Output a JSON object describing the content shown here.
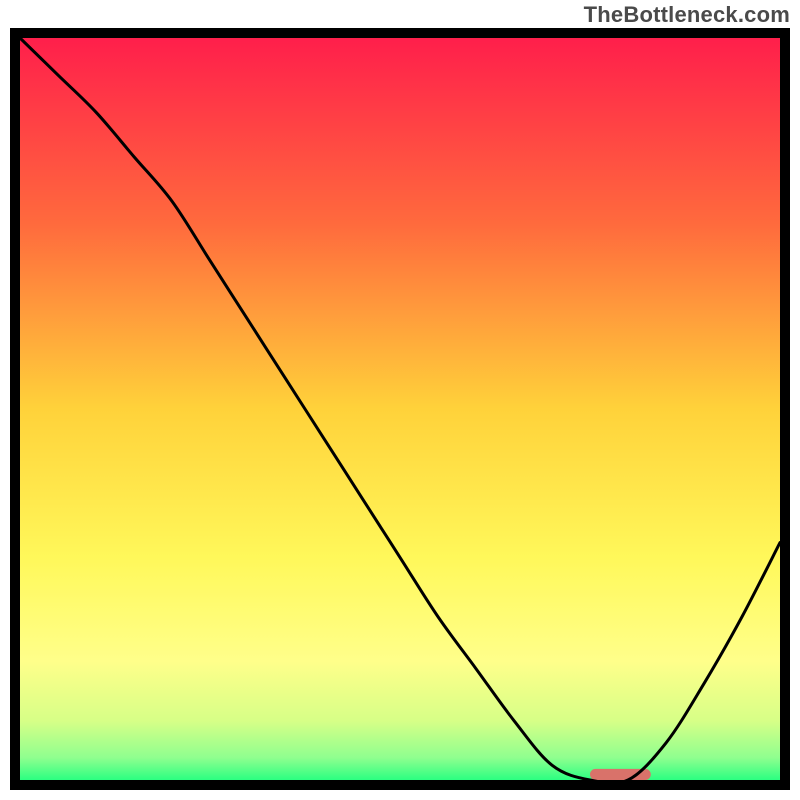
{
  "watermark": "TheBottleneck.com",
  "chart_data": {
    "type": "line",
    "title": "",
    "xlabel": "",
    "ylabel": "",
    "xlim": [
      0,
      100
    ],
    "ylim": [
      0,
      100
    ],
    "grid": false,
    "legend": false,
    "x": [
      0,
      5,
      10,
      15,
      20,
      25,
      30,
      35,
      40,
      45,
      50,
      55,
      60,
      65,
      70,
      75,
      80,
      85,
      90,
      95,
      100
    ],
    "series": [
      {
        "name": "curve",
        "color": "#000000",
        "values": [
          100,
          95,
          90,
          84,
          78,
          70,
          62,
          54,
          46,
          38,
          30,
          22,
          15,
          8,
          2,
          0,
          0,
          5,
          13,
          22,
          32
        ]
      }
    ],
    "highlight_bar": {
      "x_start": 75,
      "x_end": 83,
      "y": 0,
      "height": 1.5,
      "color": "#d9726a"
    },
    "gradient_background": {
      "stops": [
        {
          "offset": 0.0,
          "color": "#ff1f4b"
        },
        {
          "offset": 0.25,
          "color": "#ff6a3d"
        },
        {
          "offset": 0.5,
          "color": "#ffd23a"
        },
        {
          "offset": 0.7,
          "color": "#fff85a"
        },
        {
          "offset": 0.84,
          "color": "#ffff8a"
        },
        {
          "offset": 0.92,
          "color": "#d7ff87"
        },
        {
          "offset": 0.97,
          "color": "#8fff8f"
        },
        {
          "offset": 1.0,
          "color": "#2bff81"
        }
      ]
    },
    "frame_thickness_px": 10,
    "frame_color": "#000000"
  }
}
